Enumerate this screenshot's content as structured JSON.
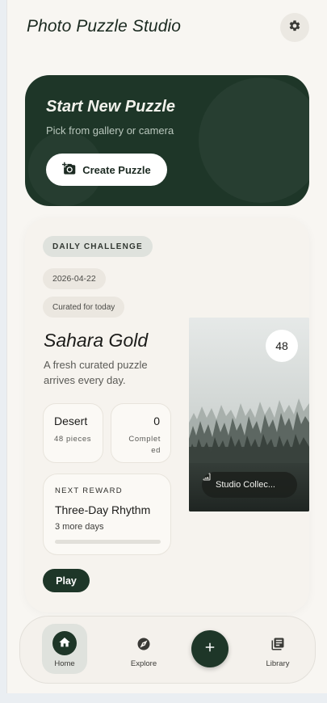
{
  "app": {
    "title": "Photo Puzzle Studio"
  },
  "hero": {
    "title": "Start New Puzzle",
    "subtitle": "Pick from gallery or camera",
    "button_label": "Create Puzzle"
  },
  "daily": {
    "chip_label": "DAILY CHALLENGE",
    "date": "2026-04-22",
    "curated_label": "Curated for today",
    "title": "Sahara Gold",
    "description": "A fresh curated puzzle arrives every day.",
    "stats": [
      {
        "value": "Desert",
        "label": "48 pieces"
      },
      {
        "value": "0",
        "label": "Completed"
      }
    ],
    "reward": {
      "label": "NEXT REWARD",
      "title": "Three-Day Rhythm",
      "subtitle": "3 more days",
      "progress": 0
    },
    "play_label": "Play",
    "preview": {
      "piece_count": "48",
      "source_label": "Studio Collec..."
    }
  },
  "nav": {
    "items": [
      {
        "label": "Home",
        "icon": "home-icon",
        "active": true
      },
      {
        "label": "Explore",
        "icon": "compass-icon",
        "active": false
      },
      {
        "label": "Library",
        "icon": "library-icon",
        "active": false
      }
    ],
    "fab_icon": "plus-icon"
  },
  "colors": {
    "accent": "#1e3628",
    "background": "#f8f6f2"
  }
}
